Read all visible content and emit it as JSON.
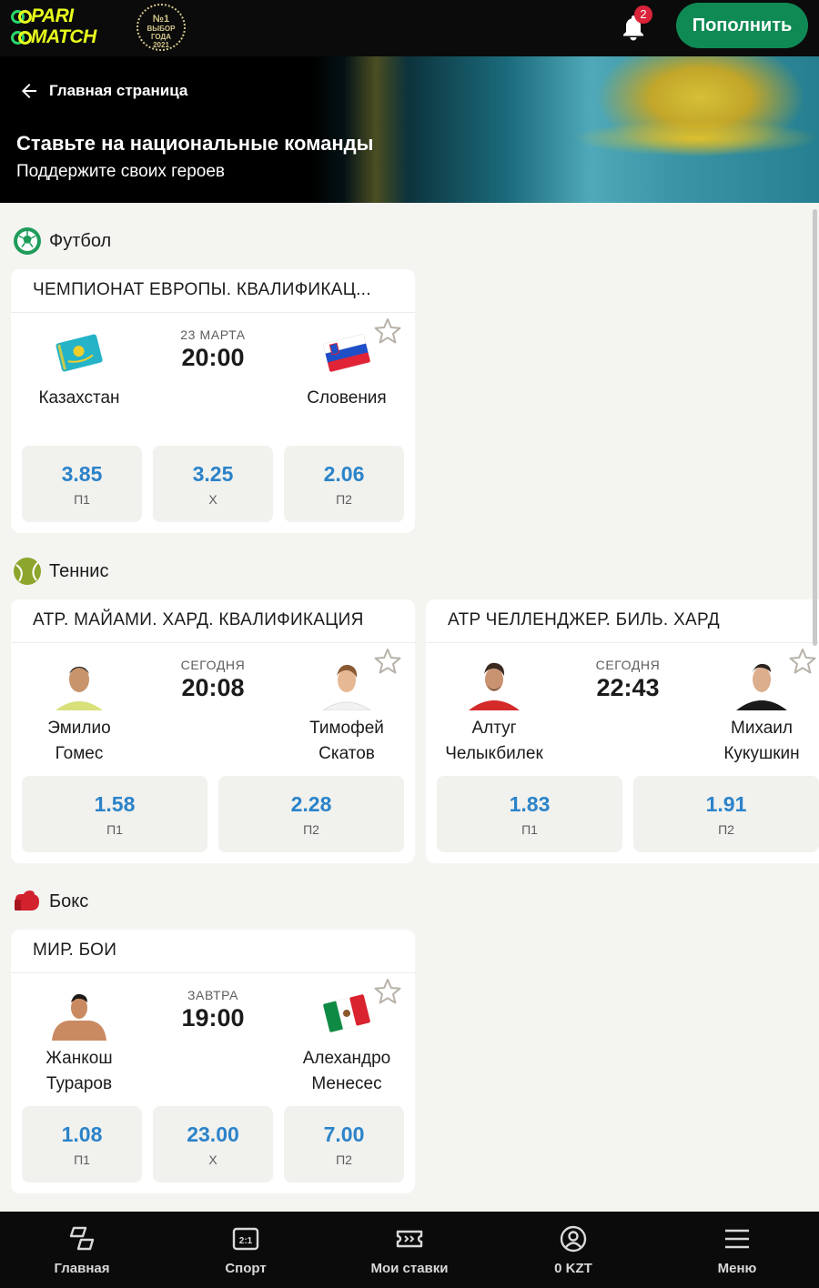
{
  "header": {
    "logo_line1": "PARI",
    "logo_line2": "MATCH",
    "award_line1": "№1",
    "award_line2": "ВЫБОР",
    "award_line3": "ГОДА",
    "award_line4": "2021",
    "notifications_count": "2",
    "deposit_label": "Пополнить"
  },
  "banner": {
    "back_label": "Главная страница",
    "title": "Ставьте на национальные команды",
    "subtitle": "Поддержите своих героев"
  },
  "sections": {
    "football": {
      "title": "Футбол",
      "events": [
        {
          "league": "ЧЕМПИОНАТ ЕВРОПЫ. КВАЛИФИКАЦ...",
          "date": "23 МАРТА",
          "time": "20:00",
          "home": "Казахстан",
          "away": "Словения",
          "odds": [
            {
              "value": "3.85",
              "label": "П1"
            },
            {
              "value": "3.25",
              "label": "Х"
            },
            {
              "value": "2.06",
              "label": "П2"
            }
          ]
        }
      ]
    },
    "tennis": {
      "title": "Теннис",
      "events": [
        {
          "league": "ATP. МАЙАМИ. ХАРД. КВАЛИФИКАЦИЯ",
          "date": "СЕГОДНЯ",
          "time": "20:08",
          "home_line1": "Эмилио",
          "home_line2": "Гомес",
          "away_line1": "Тимофей",
          "away_line2": "Скатов",
          "odds": [
            {
              "value": "1.58",
              "label": "П1"
            },
            {
              "value": "2.28",
              "label": "П2"
            }
          ]
        },
        {
          "league": "ATP ЧЕЛЛЕНДЖЕР. БИЛЬ. ХАРД",
          "date": "СЕГОДНЯ",
          "time": "22:43",
          "home_line1": "Алтуг",
          "home_line2": "Челыкбилек",
          "away_line1": "Михаил",
          "away_line2": "Кукушкин",
          "odds": [
            {
              "value": "1.83",
              "label": "П1"
            },
            {
              "value": "1.91",
              "label": "П2"
            }
          ]
        }
      ]
    },
    "boxing": {
      "title": "Бокс",
      "events": [
        {
          "league": "МИР. БОИ",
          "date": "ЗАВТРА",
          "time": "19:00",
          "home_line1": "Жанкош",
          "home_line2": "Тураров",
          "away_line1": "Алехандро",
          "away_line2": "Менесес",
          "odds": [
            {
              "value": "1.08",
              "label": "П1"
            },
            {
              "value": "23.00",
              "label": "Х"
            },
            {
              "value": "7.00",
              "label": "П2"
            }
          ]
        }
      ]
    }
  },
  "bottom_nav": [
    {
      "label": "Главная",
      "icon": "home-icon"
    },
    {
      "label": "Спорт",
      "icon": "sport-icon"
    },
    {
      "label": "Мои ставки",
      "icon": "ticket-icon"
    },
    {
      "label": "0 KZT",
      "icon": "account-icon"
    },
    {
      "label": "Меню",
      "icon": "menu-icon"
    }
  ],
  "colors": {
    "brand_green": "#0f8a54",
    "logo_yellow": "#e8ff1c",
    "odds_blue": "#2b83c9",
    "badge_red": "#d9243a"
  }
}
